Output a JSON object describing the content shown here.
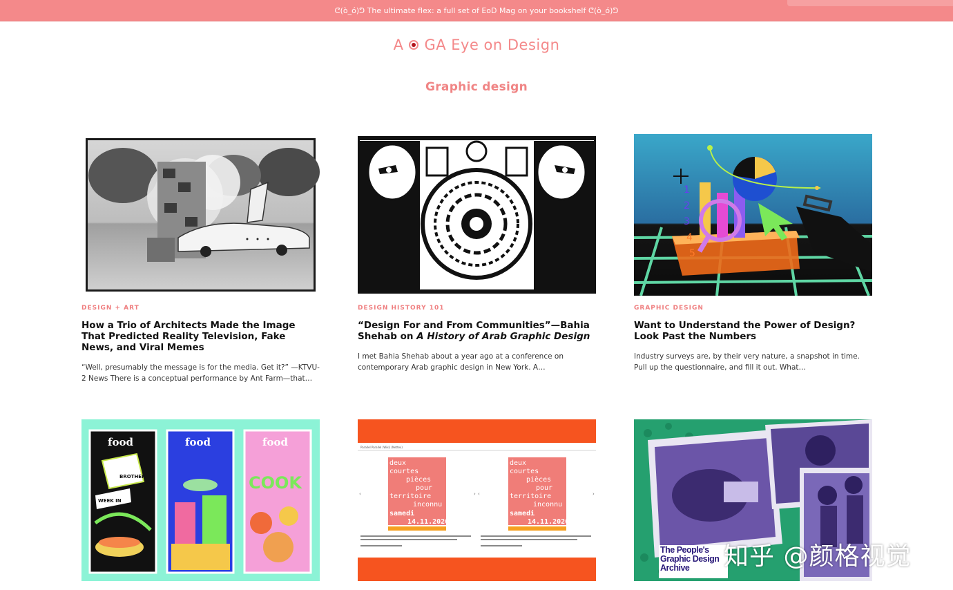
{
  "promo": {
    "text": "ᕦ(ò_ó)ᕤ The ultimate flex: a full set of EoD Mag on your bookshelf ᕦ(ò_ó)ᕤ"
  },
  "logo": {
    "text_a": "A",
    "text_rest": "GA Eye on Design"
  },
  "section": {
    "title": "Graphic design"
  },
  "articles": [
    {
      "kicker": "DESIGN + ART",
      "headline": "How a Trio of Architects Made the Image That Predicted Reality Television, Fake News, and Viral Memes",
      "excerpt": "“Well, presumably the message is for the media. Get it?” —KTVU-2 News There is a conceptual performance by Ant Farm—that…"
    },
    {
      "kicker": "DESIGN HISTORY 101",
      "headline_plain": "“Design For and From Communities”—Bahia Shehab on ",
      "headline_em": "A History of Arab Graphic Design",
      "excerpt": "I met Bahia Shehab about a year ago at a conference on contemporary Arab graphic design in New York. A…"
    },
    {
      "kicker": "GRAPHIC DESIGN",
      "headline": "Want to Understand the Power of Design? Look Past the Numbers",
      "excerpt": "Industry surveys are, by their very nature, a snapshot in time. Pull up the questionnaire, and fill it out. What…"
    }
  ],
  "thumbs": {
    "food_titles": [
      "food",
      "food",
      "food"
    ],
    "food_words": [
      "BROTHER",
      "WEEK IN",
      "COOK"
    ],
    "poster_header": "Parallel Parallel (Wiki) (Nettex)",
    "poster_lines": [
      "deux",
      "courtes",
      "pièces",
      "pour",
      "territoire",
      "inconnu",
      "samedi",
      "14.11.2020"
    ],
    "archive_caption": "The People's Graphic Design Archive",
    "tech_numbers": [
      "1",
      "2",
      "3",
      "4",
      "5"
    ]
  },
  "watermark": {
    "text": "知乎 @颜格视觉"
  },
  "colors": {
    "brand_pink": "#f4898a",
    "kicker_pink": "#ef7f80",
    "poster_orange": "#f6541f",
    "poster_red": "#f07d78"
  }
}
